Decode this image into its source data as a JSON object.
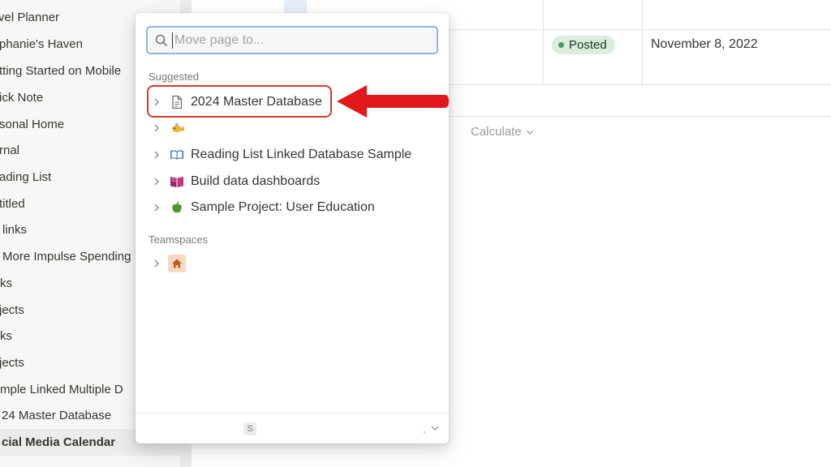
{
  "sidebar": {
    "items": [
      {
        "label": "vel Planner"
      },
      {
        "label": "phanie's Haven"
      },
      {
        "label": "tting Started on Mobile"
      },
      {
        "label": "ick Note"
      },
      {
        "label": "sonal Home"
      },
      {
        "label": "rnal"
      },
      {
        "label": "ading List"
      },
      {
        "label": "titled"
      },
      {
        "label": "links"
      },
      {
        "label": "More Impulse Spending"
      },
      {
        "label": "ks"
      },
      {
        "label": "jects"
      },
      {
        "label": "ks"
      },
      {
        "label": "jects"
      },
      {
        "label": "mple Linked Multiple D"
      },
      {
        "label": "24 Master Database"
      },
      {
        "label": "cial Media Calendar"
      }
    ]
  },
  "table": {
    "status": "Posted",
    "date": "November 8, 2022",
    "calculate": "Calculate"
  },
  "popup": {
    "search": {
      "placeholder": "Move page to...",
      "value": ""
    },
    "suggested_label": "Suggested",
    "suggested": [
      {
        "label": "2024 Master Database",
        "icon": "page-icon"
      },
      {
        "label": "",
        "icon": "fish-emoji-icon"
      },
      {
        "label": "Reading List Linked Database Sample",
        "icon": "open-book-icon"
      },
      {
        "label": "Build data dashboards",
        "icon": "book-icon"
      },
      {
        "label": "Sample Project: User Education",
        "icon": "green-apple-icon"
      }
    ],
    "teamspaces_label": "Teamspaces",
    "teamspaces": [
      {
        "label": "",
        "icon": "house-icon"
      }
    ],
    "footer_key": "S"
  },
  "colors": {
    "status_bg": "#dbeddb",
    "status_dot": "#4f9768",
    "annotation_red": "#d33b30",
    "search_border": "#8fb6e3"
  }
}
